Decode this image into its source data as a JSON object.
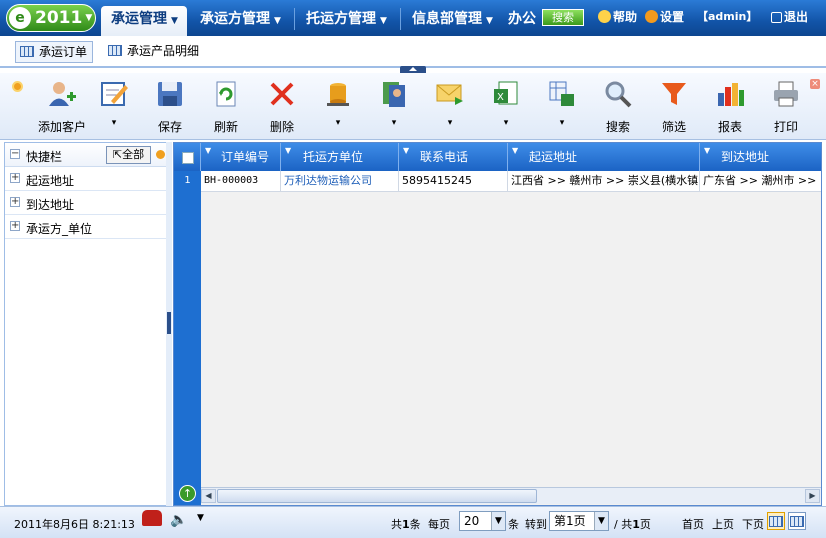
{
  "brand": {
    "logo_glyph": "e",
    "year": "2011"
  },
  "nav": {
    "tabs": [
      {
        "label": "承运管理",
        "active": true
      },
      {
        "label": "承运方管理"
      },
      {
        "label": "托运方管理"
      },
      {
        "label": "信息部管理"
      },
      {
        "label": "办公"
      }
    ],
    "search_label": "搜索",
    "help_label": "帮助",
    "settings_label": "设置",
    "user_label": "【admin】",
    "logout_label": "退出"
  },
  "subtabs": [
    {
      "label": "承运订单",
      "active": true
    },
    {
      "label": "承运产品明细"
    }
  ],
  "toolbar": {
    "buttons": [
      {
        "label": "添加客户",
        "icon": "add-user-icon"
      },
      {
        "label": "▾",
        "icon": "edit-icon"
      },
      {
        "label": "保存",
        "icon": "save-icon"
      },
      {
        "label": "刷新",
        "icon": "refresh-icon"
      },
      {
        "label": "删除",
        "icon": "delete-icon"
      },
      {
        "label": "▾",
        "icon": "database-icon"
      },
      {
        "label": "▾",
        "icon": "contacts-icon"
      },
      {
        "label": "▾",
        "icon": "mail-icon"
      },
      {
        "label": "▾",
        "icon": "excel-export-icon"
      },
      {
        "label": "▾",
        "icon": "excel-import-icon"
      },
      {
        "label": "搜索",
        "icon": "search-icon"
      },
      {
        "label": "筛选",
        "icon": "filter-icon"
      },
      {
        "label": "报表",
        "icon": "report-icon"
      },
      {
        "label": "打印",
        "icon": "print-icon"
      }
    ]
  },
  "quickbar": {
    "title": "快捷栏",
    "all_label": "全部",
    "items": [
      "起运地址",
      "到达地址",
      "承运方_单位"
    ]
  },
  "grid": {
    "columns": [
      "订单编号",
      "托运方单位",
      "联系电话",
      "起运地址",
      "到达地址"
    ],
    "rows": [
      {
        "num": "1",
        "order_no": "BH-000003",
        "shipper": "万利达物运输公司",
        "phone": "5895415245",
        "origin": "江西省 >> 赣州市 >> 崇义县(横水镇)",
        "dest": "广东省 >> 潮州市 >>"
      }
    ]
  },
  "status": {
    "datetime": "2011年8月6日 8:21:13",
    "total_prefix": "共",
    "total_count": "1",
    "total_suffix": "条",
    "per_page_label": "每页",
    "per_page_value": "20",
    "per_page_unit": "条",
    "goto_label": "转到",
    "page_select": "第1页",
    "page_total_prefix": "/ 共",
    "page_total": "1",
    "page_total_suffix": "页",
    "first": "首页",
    "prev": "上页",
    "next": "下页"
  }
}
